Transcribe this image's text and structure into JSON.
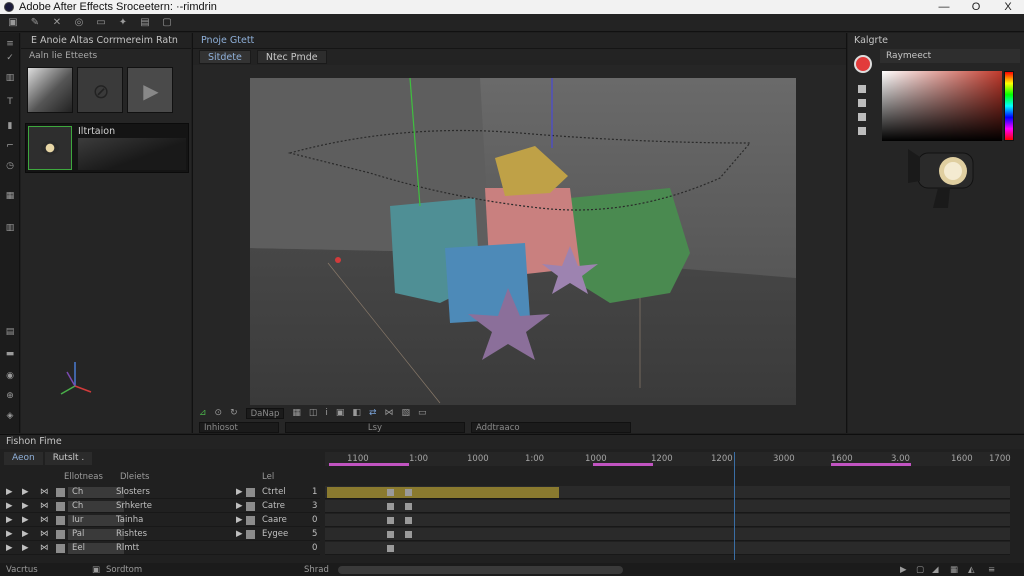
{
  "window": {
    "title": "Adobe After Effects Sroceetern: ·-rimdrin",
    "controls": {
      "minimize": "—",
      "maximize": "O",
      "close": "X"
    }
  },
  "toolbar": {
    "icons": [
      "folder-icon",
      "pen-icon",
      "x-icon",
      "globe-icon",
      "rectangle-icon",
      "star-icon",
      "camera-icon",
      "selection-icon"
    ]
  },
  "project": {
    "title": "E Anoie Altas Corrmereim Ratn",
    "subtitle": "Aaln lie Etteets",
    "asset_name": "Iltrtaion"
  },
  "viewer": {
    "panel_title": "Pnoje Gtett",
    "tabs": [
      "Sitdete",
      "Ntec Pmde"
    ],
    "bottom_fields": [
      "DaNap",
      "Lsy",
      "Addtraaco",
      "Inhiosot"
    ]
  },
  "right_panel": {
    "title": "Kalgrte",
    "tab": "Raymeect",
    "accent": "#e23b3b"
  },
  "timeline": {
    "title": "Fishon Fime",
    "tabs": [
      "Aeon",
      "Rutslt ."
    ],
    "headers": [
      "Ellotneas",
      "Dleiets",
      "Lel"
    ],
    "ruler_ticks": [
      "1100",
      "1:00",
      "1000",
      "1:00",
      "1000",
      "1200",
      "1200",
      "3000",
      "1600",
      "3.00",
      "1600",
      "1700"
    ],
    "layers": [
      {
        "index": "Ch",
        "name": "Slosters",
        "param": "Ctrtel",
        "num": "1"
      },
      {
        "index": "Ch",
        "name": "Srhkerte",
        "param": "Catre",
        "num": "3"
      },
      {
        "index": "Iur",
        "name": "Tainha",
        "param": "Caare",
        "num": "0"
      },
      {
        "index": "Pal",
        "name": "Rishtes",
        "param": "Eygee",
        "num": "5"
      },
      {
        "index": "Eel",
        "name": "Rlmtt",
        "param": "",
        "num": "0"
      }
    ],
    "bottom_left": "Vacrtus",
    "bottom_mid": "Sordtom",
    "bottom_scroll": "Shrad"
  }
}
